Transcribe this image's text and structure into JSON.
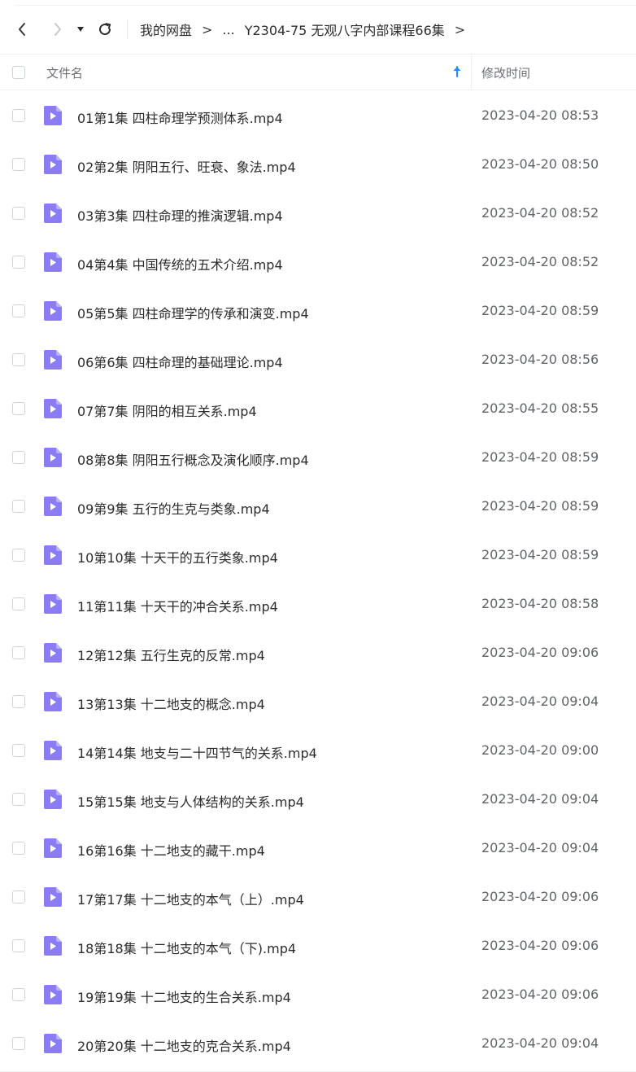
{
  "breadcrumb": {
    "root": "我的网盘",
    "separator": ">",
    "ellipsis": "...",
    "current": "Y2304-75 无观八字内部课程66集"
  },
  "table": {
    "header_name": "文件名",
    "header_time": "修改时间",
    "sort": "ascending"
  },
  "icons": {
    "back": "chevron-left-icon",
    "forward": "chevron-right-icon",
    "dropdown": "caret-down-icon",
    "refresh": "refresh-icon",
    "sort": "arrow-up-icon",
    "file": "video-file-icon"
  },
  "colors": {
    "file_icon": "#8b7cf6",
    "sort_arrow": "#1e90ff"
  },
  "files": [
    {
      "name": "01第1集 四柱命理学预测体系.mp4",
      "time": "2023-04-20 08:53"
    },
    {
      "name": "02第2集 阴阳五行、旺衰、象法.mp4",
      "time": "2023-04-20 08:50"
    },
    {
      "name": "03第3集 四柱命理的推演逻辑.mp4",
      "time": "2023-04-20 08:52"
    },
    {
      "name": "04第4集 中国传统的五术介绍.mp4",
      "time": "2023-04-20 08:52"
    },
    {
      "name": "05第5集 四柱命理学的传承和演变.mp4",
      "time": "2023-04-20 08:59"
    },
    {
      "name": "06第6集 四柱命理的基础理论.mp4",
      "time": "2023-04-20 08:56"
    },
    {
      "name": "07第7集 阴阳的相互关系.mp4",
      "time": "2023-04-20 08:55"
    },
    {
      "name": "08第8集 阴阳五行概念及演化顺序.mp4",
      "time": "2023-04-20 08:59"
    },
    {
      "name": "09第9集 五行的生克与类象.mp4",
      "time": "2023-04-20 08:59"
    },
    {
      "name": "10第10集 十天干的五行类象.mp4",
      "time": "2023-04-20 08:59"
    },
    {
      "name": "11第11集 十天干的冲合关系.mp4",
      "time": "2023-04-20 08:58"
    },
    {
      "name": "12第12集 五行生克的反常.mp4",
      "time": "2023-04-20 09:06"
    },
    {
      "name": "13第13集 十二地支的概念.mp4",
      "time": "2023-04-20 09:04"
    },
    {
      "name": "14第14集 地支与二十四节气的关系.mp4",
      "time": "2023-04-20 09:00"
    },
    {
      "name": "15第15集 地支与人体结构的关系.mp4",
      "time": "2023-04-20 09:04"
    },
    {
      "name": "16第16集 十二地支的藏干.mp4",
      "time": "2023-04-20 09:04"
    },
    {
      "name": "17第17集 十二地支的本气（上）.mp4",
      "time": "2023-04-20 09:06"
    },
    {
      "name": "18第18集 十二地支的本气（下).mp4",
      "time": "2023-04-20 09:06"
    },
    {
      "name": "19第19集 十二地支的生合关系.mp4",
      "time": "2023-04-20 09:06"
    },
    {
      "name": "20第20集 十二地支的克合关系.mp4",
      "time": "2023-04-20 09:04"
    }
  ]
}
